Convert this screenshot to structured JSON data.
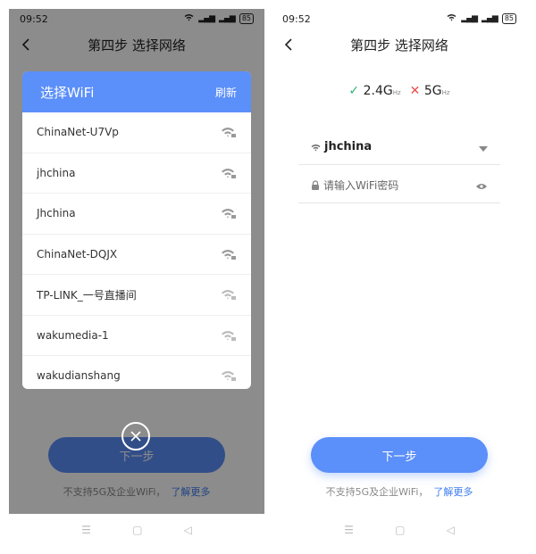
{
  "left": {
    "status": {
      "time": "09:52",
      "battery": "85"
    },
    "nav": {
      "title": "第四步 选择网络"
    },
    "modal": {
      "title": "选择WiFi",
      "refresh": "刷新",
      "networks": [
        {
          "ssid": "ChinaNet-U7Vp"
        },
        {
          "ssid": "jhchina"
        },
        {
          "ssid": "Jhchina"
        },
        {
          "ssid": "ChinaNet-DQJX"
        },
        {
          "ssid": "TP-LINK_一号直播间"
        },
        {
          "ssid": "wakumedia-1"
        },
        {
          "ssid": "wakudianshang"
        }
      ]
    },
    "next_button": "下一步",
    "footnote": {
      "text": "不支持5G及企业WiFi，",
      "link": "了解更多"
    }
  },
  "right": {
    "status": {
      "time": "09:52",
      "battery": "85"
    },
    "nav": {
      "title": "第四步 选择网络"
    },
    "freq": {
      "ok_mark": "✓",
      "ghz24": "2.4G",
      "no_mark": "✕",
      "ghz5": "5G",
      "unit": "Hz"
    },
    "ssid": "jhchina",
    "password_placeholder": "请输入WiFi密码",
    "next_button": "下一步",
    "footnote": {
      "text": "不支持5G及企业WiFi，",
      "link": "了解更多"
    }
  },
  "colors": {
    "accent": "#5b8ff9",
    "link": "#3d7cf0",
    "ok": "#2bb673",
    "no": "#e94d4d"
  },
  "icons": {
    "back": "chevron-left-icon",
    "wifi": "wifi-icon",
    "lock": "lock-icon",
    "dropdown": "caret-down-icon",
    "eye": "eye-icon",
    "close": "close-icon"
  }
}
